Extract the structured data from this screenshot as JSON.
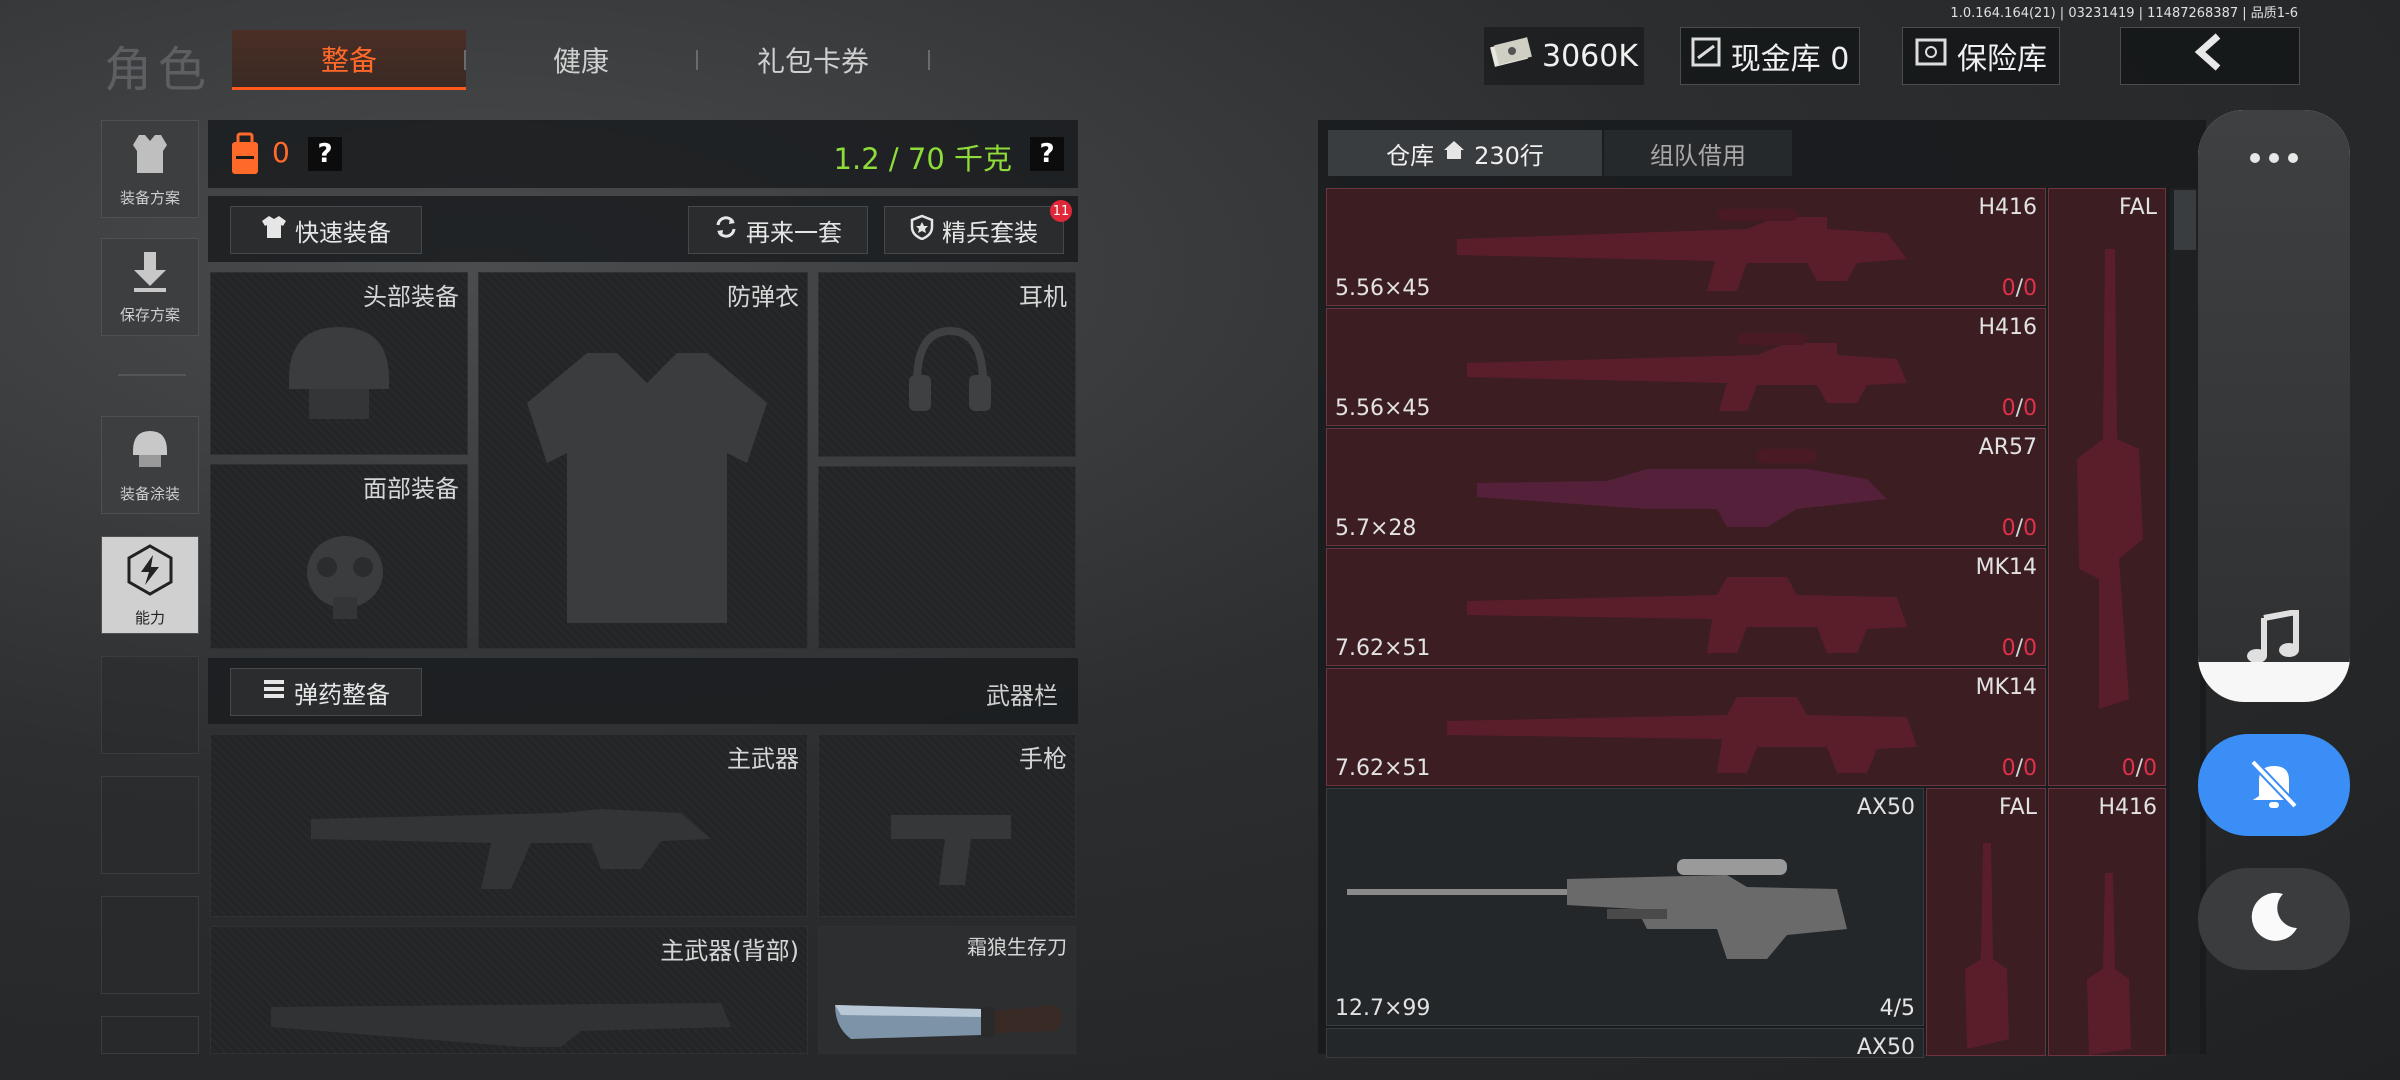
{
  "version": "1.0.164.164(21) | 03231419 | 11487268387 | 品质1-6",
  "header": {
    "title": "角色",
    "tabs": [
      "整备",
      "健康",
      "礼包卡券"
    ],
    "currency": "3060K",
    "cash_vault": "现金库 0",
    "insurance": "保险库",
    "back_icon": "chevron-left-icon"
  },
  "sidebar": {
    "items": [
      {
        "label": "装备方案",
        "icon": "vest-icon"
      },
      {
        "label": "保存方案",
        "icon": "download-icon"
      },
      {
        "label": "装备涂装",
        "icon": "helmet-icon"
      },
      {
        "label": "能力",
        "icon": "lightning-icon"
      }
    ]
  },
  "loadout": {
    "backpack_count": "0",
    "weight": "1.2 / 70 千克",
    "help": "?",
    "quick_equip": "快速装备",
    "repeat_set": "再来一套",
    "elite_set": "精兵套装",
    "elite_badge": "11",
    "slots": {
      "head": "头部装备",
      "armor": "防弹衣",
      "headset": "耳机",
      "face": "面部装备"
    },
    "ammo_button": "弹药整备",
    "weapon_bar": "武器栏",
    "weapon_slots": {
      "primary": "主武器",
      "pistol": "手枪",
      "primary_back": "主武器(背部)",
      "knife": "霜狼生存刀"
    }
  },
  "warehouse": {
    "tab_label": "仓库",
    "tab_rows": "230行",
    "team_tab": "组队借用",
    "items": [
      {
        "name": "H416",
        "caliber": "5.56×45",
        "count_a": "0",
        "count_b": "0"
      },
      {
        "name": "H416",
        "caliber": "5.56×45",
        "count_a": "0",
        "count_b": "0"
      },
      {
        "name": "AR57",
        "caliber": "5.7×28",
        "count_a": "0",
        "count_b": "0"
      },
      {
        "name": "MK14",
        "caliber": "7.62×51",
        "count_a": "0",
        "count_b": "0"
      },
      {
        "name": "MK14",
        "caliber": "7.62×51",
        "count_a": "0",
        "count_b": "0"
      }
    ],
    "fal_tall": {
      "name": "FAL",
      "count_a": "0",
      "count_b": "0"
    },
    "ax50": {
      "name": "AX50",
      "caliber": "12.7×99",
      "count": "4/5"
    },
    "fal_2": {
      "name": "FAL"
    },
    "h416_3": {
      "name": "H416"
    },
    "ax50_2": {
      "name": "AX50"
    }
  },
  "overlay": {
    "more_icon": "more-dots-icon",
    "music_icon": "music-note-icon",
    "mute_icon": "bell-muted-icon",
    "moon_icon": "moon-icon"
  },
  "colors": {
    "accent": "#ff6a2a",
    "weight_green": "#8edc3a",
    "weapon_red": "#3b1d22",
    "count_red": "#e0304a",
    "mute_blue": "#3a8ef5"
  }
}
